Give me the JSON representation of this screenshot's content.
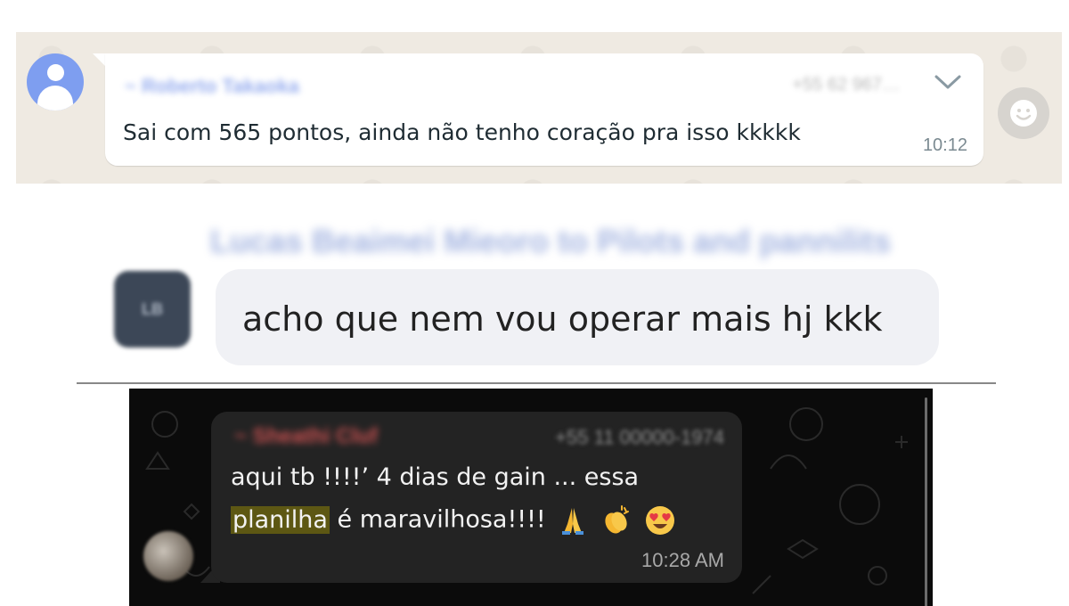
{
  "panel_whatsapp_light": {
    "sender": "~ Roberto Takaoka",
    "phone": "+55 62 967…",
    "message": "Sai com 565 pontos, ainda não tenho coração pra isso kkkkk",
    "time": "10:12",
    "menu_icon": "chevron-down-icon",
    "reaction_icon": "emoji-smile-icon",
    "colors": {
      "background": "#efeae2",
      "bubble": "#ffffff",
      "sender": "#6b8be8"
    }
  },
  "panel_group_chat": {
    "header": "Lucas Beaimei Mieoro to Pilots and pannilits",
    "avatar_initials": "LB",
    "message": "acho que nem vou operar mais hj kkk",
    "colors": {
      "bubble": "#f0f1f5",
      "avatar": "#3c4757"
    }
  },
  "panel_whatsapp_dark": {
    "sender": "~ Sheathi Cluf",
    "phone": "+55 11 00000-1974",
    "message_line1": "aqui tb !!!!’ 4 dias de gain ... essa",
    "message_highlight": "planilha",
    "message_line2_rest": " é maravilhosa!!!!",
    "emojis": [
      "folded-hands-icon",
      "clapping-hands-icon",
      "heart-eyes-icon"
    ],
    "time": "10:28 AM",
    "colors": {
      "background": "#0b0b0b",
      "bubble": "#232323",
      "highlight": "#5d5713",
      "sender": "#e85a5a"
    }
  }
}
